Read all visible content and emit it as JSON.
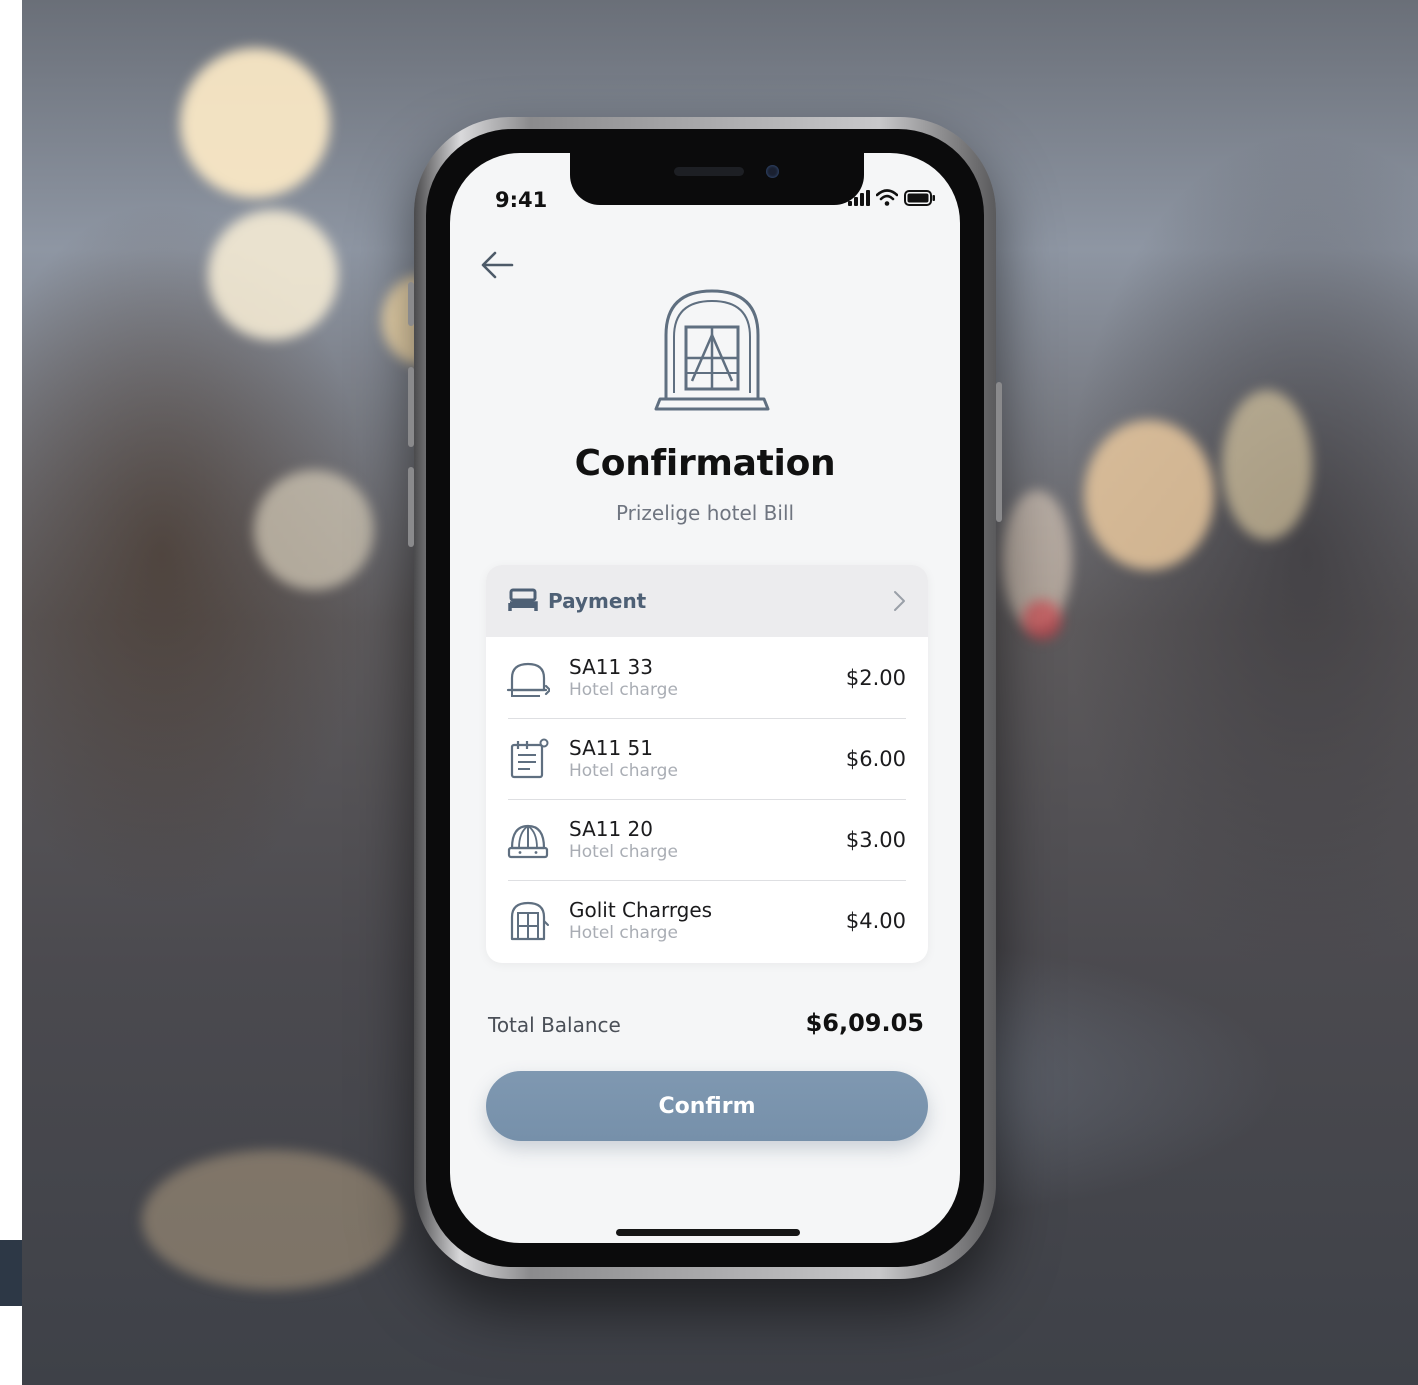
{
  "status_bar": {
    "time": "9:41"
  },
  "screen": {
    "title": "Confirmation",
    "subtitle": "Prizelige hotel Bill"
  },
  "payment_card": {
    "header_label": "Payment",
    "items": [
      {
        "code": "SA11 33",
        "description": "Hotel charge",
        "amount": "$2.00",
        "icon": "bell-icon"
      },
      {
        "code": "SA11 51",
        "description": "Hotel charge",
        "amount": "$6.00",
        "icon": "notepad-icon"
      },
      {
        "code": "SA11 20",
        "description": "Hotel charge",
        "amount": "$3.00",
        "icon": "dome-icon"
      },
      {
        "code": "Golit Charrges",
        "description": "Hotel charge",
        "amount": "$4.00",
        "icon": "arched-window-icon"
      }
    ]
  },
  "total": {
    "label": "Total Balance",
    "value": "$6,09.05"
  },
  "confirm_button": {
    "label": "Confirm"
  },
  "colors": {
    "accent": "#7b94ad",
    "header_text": "#4e6075",
    "icon_stroke": "#5f6f80"
  }
}
